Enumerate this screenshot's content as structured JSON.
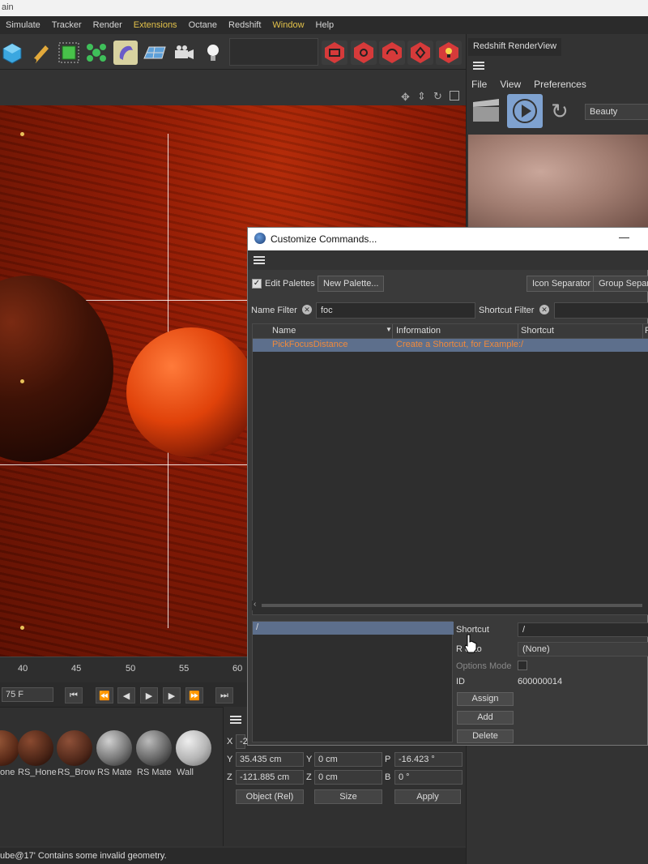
{
  "app": {
    "title_fragment": "ain",
    "menus": [
      "Simulate",
      "Tracker",
      "Render",
      "Extensions",
      "Octane",
      "Redshift",
      "Window",
      "Help"
    ]
  },
  "toolbar": {
    "icons": [
      "cube-icon",
      "pen-icon",
      "extrude-icon",
      "cloner-icon",
      "deformer-icon",
      "floor-icon",
      "camera-icon",
      "light-icon"
    ],
    "redshift_icons": [
      "rs-display-icon",
      "rs-camera-icon",
      "rs-settings-icon",
      "rs-object-icon",
      "rs-light-icon"
    ]
  },
  "timeline": {
    "ticks": [
      "40",
      "45",
      "50",
      "55",
      "60"
    ],
    "current_frame": "75 F"
  },
  "materials": [
    {
      "label": "one",
      "color": "#5a2a18"
    },
    {
      "label": "RS_Hone",
      "color": "#4a2416"
    },
    {
      "label": "RS_Brow",
      "color": "#50281a"
    },
    {
      "label": "RS Mate",
      "color": "#777777"
    },
    {
      "label": "RS Mate",
      "color": "#666666"
    },
    {
      "label": "Wall",
      "color": "#b5b5b5"
    }
  ],
  "coords": {
    "x_label": "X",
    "x_value": "-2",
    "y_label": "Y",
    "y_value": "35.435 cm",
    "y2_label": "Y",
    "y2_value": "0 cm",
    "p_label": "P",
    "p_value": "-16.423 °",
    "z_label": "Z",
    "z_value": "-121.885 cm",
    "z2_label": "Z",
    "z2_value": "0 cm",
    "b_label": "B",
    "b_value": "0 °",
    "mode": "Object (Rel)",
    "size": "Size",
    "apply": "Apply"
  },
  "status": "ube@17' Contains some invalid geometry.",
  "renderview": {
    "tab": "Redshift RenderView",
    "menu": [
      "File",
      "View",
      "Preferences"
    ],
    "aov": "Beauty"
  },
  "dialog": {
    "title": "Customize Commands...",
    "minimize": "—",
    "edit_palettes_label": "Edit Palettes",
    "new_palette": "New Palette...",
    "icon_separator": "Icon Separator",
    "group_separator": "Group Separa",
    "name_filter_label": "Name Filter",
    "name_filter_value": "foc",
    "shortcut_filter_label": "Shortcut Filter",
    "shortcut_filter_value": "",
    "columns": [
      "Name",
      "Information",
      "Shortcut",
      "P"
    ],
    "rows": [
      {
        "name": "PickFocusDistance",
        "info": "Create a Shortcut, for Example:",
        "shortcut": "/"
      }
    ],
    "shortcut_list_item": "/",
    "props": {
      "shortcut_label": "Shortcut",
      "shortcut_value": "/",
      "restrict_label": "R   ct to",
      "restrict_value": "(None)",
      "options_mode_label": "Options Mode",
      "id_label": "ID",
      "id_value": "600000014"
    },
    "buttons": {
      "assign": "Assign",
      "add": "Add",
      "delete": "Delete"
    }
  },
  "colors": {
    "accent_orange": "#f08a3c",
    "selection_blue": "#5d6f8c",
    "menu_highlight": "#e3c24a"
  }
}
